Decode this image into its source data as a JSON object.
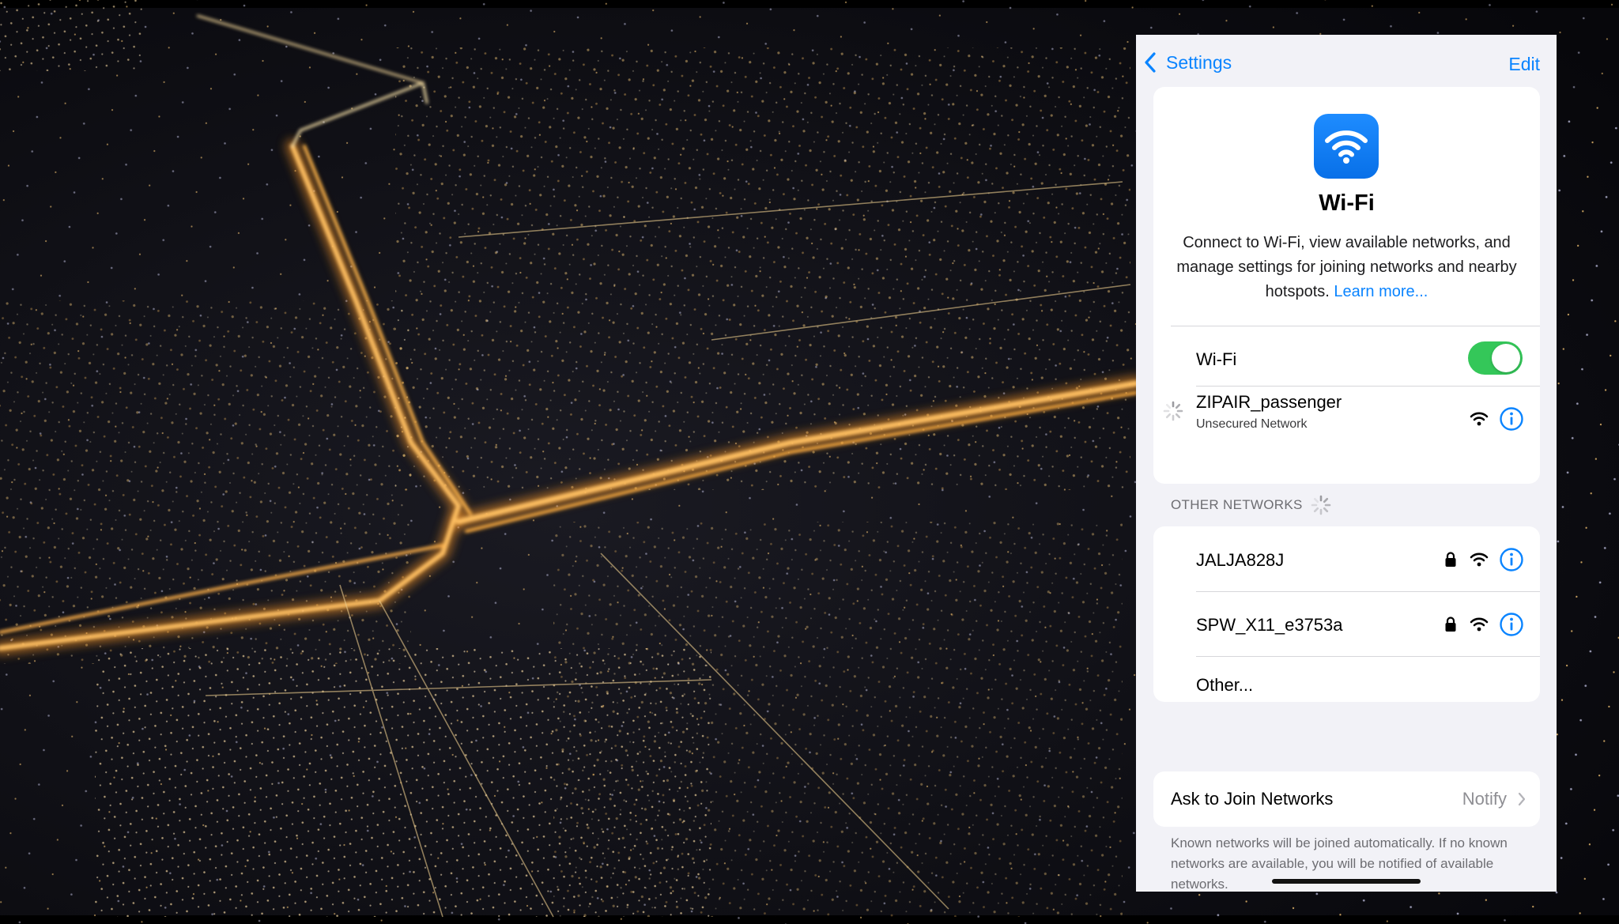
{
  "nav": {
    "back_label": "Settings",
    "edit_label": "Edit"
  },
  "hero": {
    "title": "Wi-Fi",
    "description": "Connect to Wi-Fi, view available networks, and manage settings for joining networks and nearby hotspots.",
    "learn_more": "Learn more..."
  },
  "wifi_toggle": {
    "label": "Wi-Fi",
    "enabled": true
  },
  "current_network": {
    "name": "ZIPAIR_passenger",
    "status": "Unsecured Network"
  },
  "other_networks": {
    "header": "OTHER NETWORKS",
    "items": [
      {
        "name": "JALJA828J",
        "secured": true
      },
      {
        "name": "SPW_X11_e3753a",
        "secured": true
      }
    ],
    "other_label": "Other..."
  },
  "ask_to_join": {
    "label": "Ask to Join Networks",
    "value": "Notify"
  },
  "footnote": "Known networks will be joined automatically. If no known networks are available, you will be notified of available networks.",
  "colors": {
    "accent": "#0a84ff",
    "toggle_on": "#34c759",
    "background": "#f2f2f7"
  },
  "icons": {
    "app": "wifi-icon",
    "back": "chevron-left-icon",
    "signal": "wifi-signal-icon",
    "lock": "lock-icon",
    "info": "info-icon",
    "spinner": "loading-spinner-icon",
    "disclosure": "chevron-right-icon"
  }
}
